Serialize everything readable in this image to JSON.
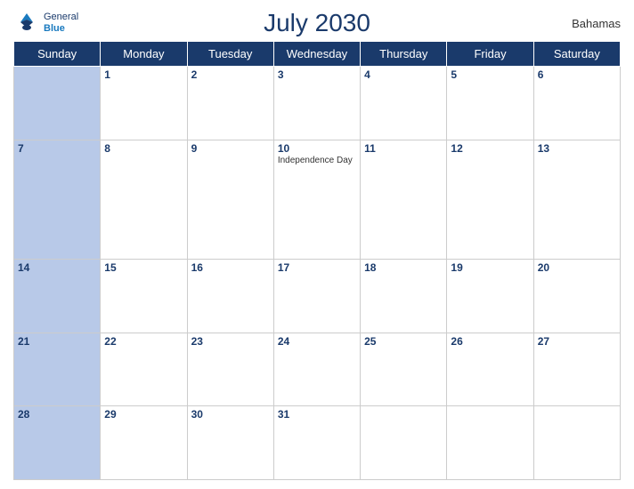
{
  "header": {
    "title": "July 2030",
    "country": "Bahamas",
    "logo": {
      "line1": "General",
      "line2": "Blue"
    }
  },
  "weekdays": [
    "Sunday",
    "Monday",
    "Tuesday",
    "Wednesday",
    "Thursday",
    "Friday",
    "Saturday"
  ],
  "weeks": [
    [
      {
        "date": "",
        "event": ""
      },
      {
        "date": "1",
        "event": ""
      },
      {
        "date": "2",
        "event": ""
      },
      {
        "date": "3",
        "event": ""
      },
      {
        "date": "4",
        "event": ""
      },
      {
        "date": "5",
        "event": ""
      },
      {
        "date": "6",
        "event": ""
      }
    ],
    [
      {
        "date": "7",
        "event": ""
      },
      {
        "date": "8",
        "event": ""
      },
      {
        "date": "9",
        "event": ""
      },
      {
        "date": "10",
        "event": "Independence Day"
      },
      {
        "date": "11",
        "event": ""
      },
      {
        "date": "12",
        "event": ""
      },
      {
        "date": "13",
        "event": ""
      }
    ],
    [
      {
        "date": "14",
        "event": ""
      },
      {
        "date": "15",
        "event": ""
      },
      {
        "date": "16",
        "event": ""
      },
      {
        "date": "17",
        "event": ""
      },
      {
        "date": "18",
        "event": ""
      },
      {
        "date": "19",
        "event": ""
      },
      {
        "date": "20",
        "event": ""
      }
    ],
    [
      {
        "date": "21",
        "event": ""
      },
      {
        "date": "22",
        "event": ""
      },
      {
        "date": "23",
        "event": ""
      },
      {
        "date": "24",
        "event": ""
      },
      {
        "date": "25",
        "event": ""
      },
      {
        "date": "26",
        "event": ""
      },
      {
        "date": "27",
        "event": ""
      }
    ],
    [
      {
        "date": "28",
        "event": ""
      },
      {
        "date": "29",
        "event": ""
      },
      {
        "date": "30",
        "event": ""
      },
      {
        "date": "31",
        "event": ""
      },
      {
        "date": "",
        "event": ""
      },
      {
        "date": "",
        "event": ""
      },
      {
        "date": "",
        "event": ""
      }
    ]
  ]
}
